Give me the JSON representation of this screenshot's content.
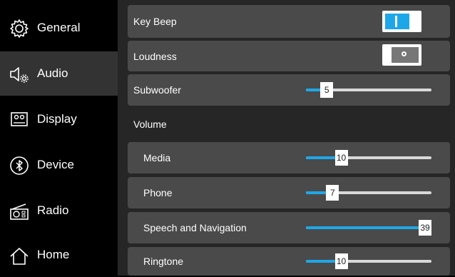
{
  "sidebar": {
    "items": [
      {
        "label": "General",
        "icon": "gear-icon"
      },
      {
        "label": "Audio",
        "icon": "speaker-gear-icon"
      },
      {
        "label": "Display",
        "icon": "display-icon"
      },
      {
        "label": "Device",
        "icon": "bluetooth-icon"
      },
      {
        "label": "Radio",
        "icon": "radio-icon"
      },
      {
        "label": "Home",
        "icon": "home-icon"
      }
    ],
    "active_index": 1
  },
  "settings": {
    "key_beep": {
      "label": "Key Beep",
      "on": true
    },
    "loudness": {
      "label": "Loudness",
      "on": false
    },
    "subwoofer": {
      "label": "Subwoofer",
      "value": 5,
      "min": 0,
      "max": 39,
      "value_text": "5"
    },
    "volume_section": "Volume",
    "volume": [
      {
        "label": "Media",
        "value": 10,
        "value_text": "10"
      },
      {
        "label": "Phone",
        "value": 7,
        "value_text": "7"
      },
      {
        "label": "Speech and Navigation",
        "value": 39,
        "value_text": "39"
      },
      {
        "label": "Ringtone",
        "value": 10,
        "value_text": "10"
      }
    ],
    "slider_max": 39
  },
  "colors": {
    "accent": "#1ea7e8",
    "row_bg": "#4a4a4a",
    "sidebar_active": "#333333",
    "panel_bg": "#262626"
  }
}
